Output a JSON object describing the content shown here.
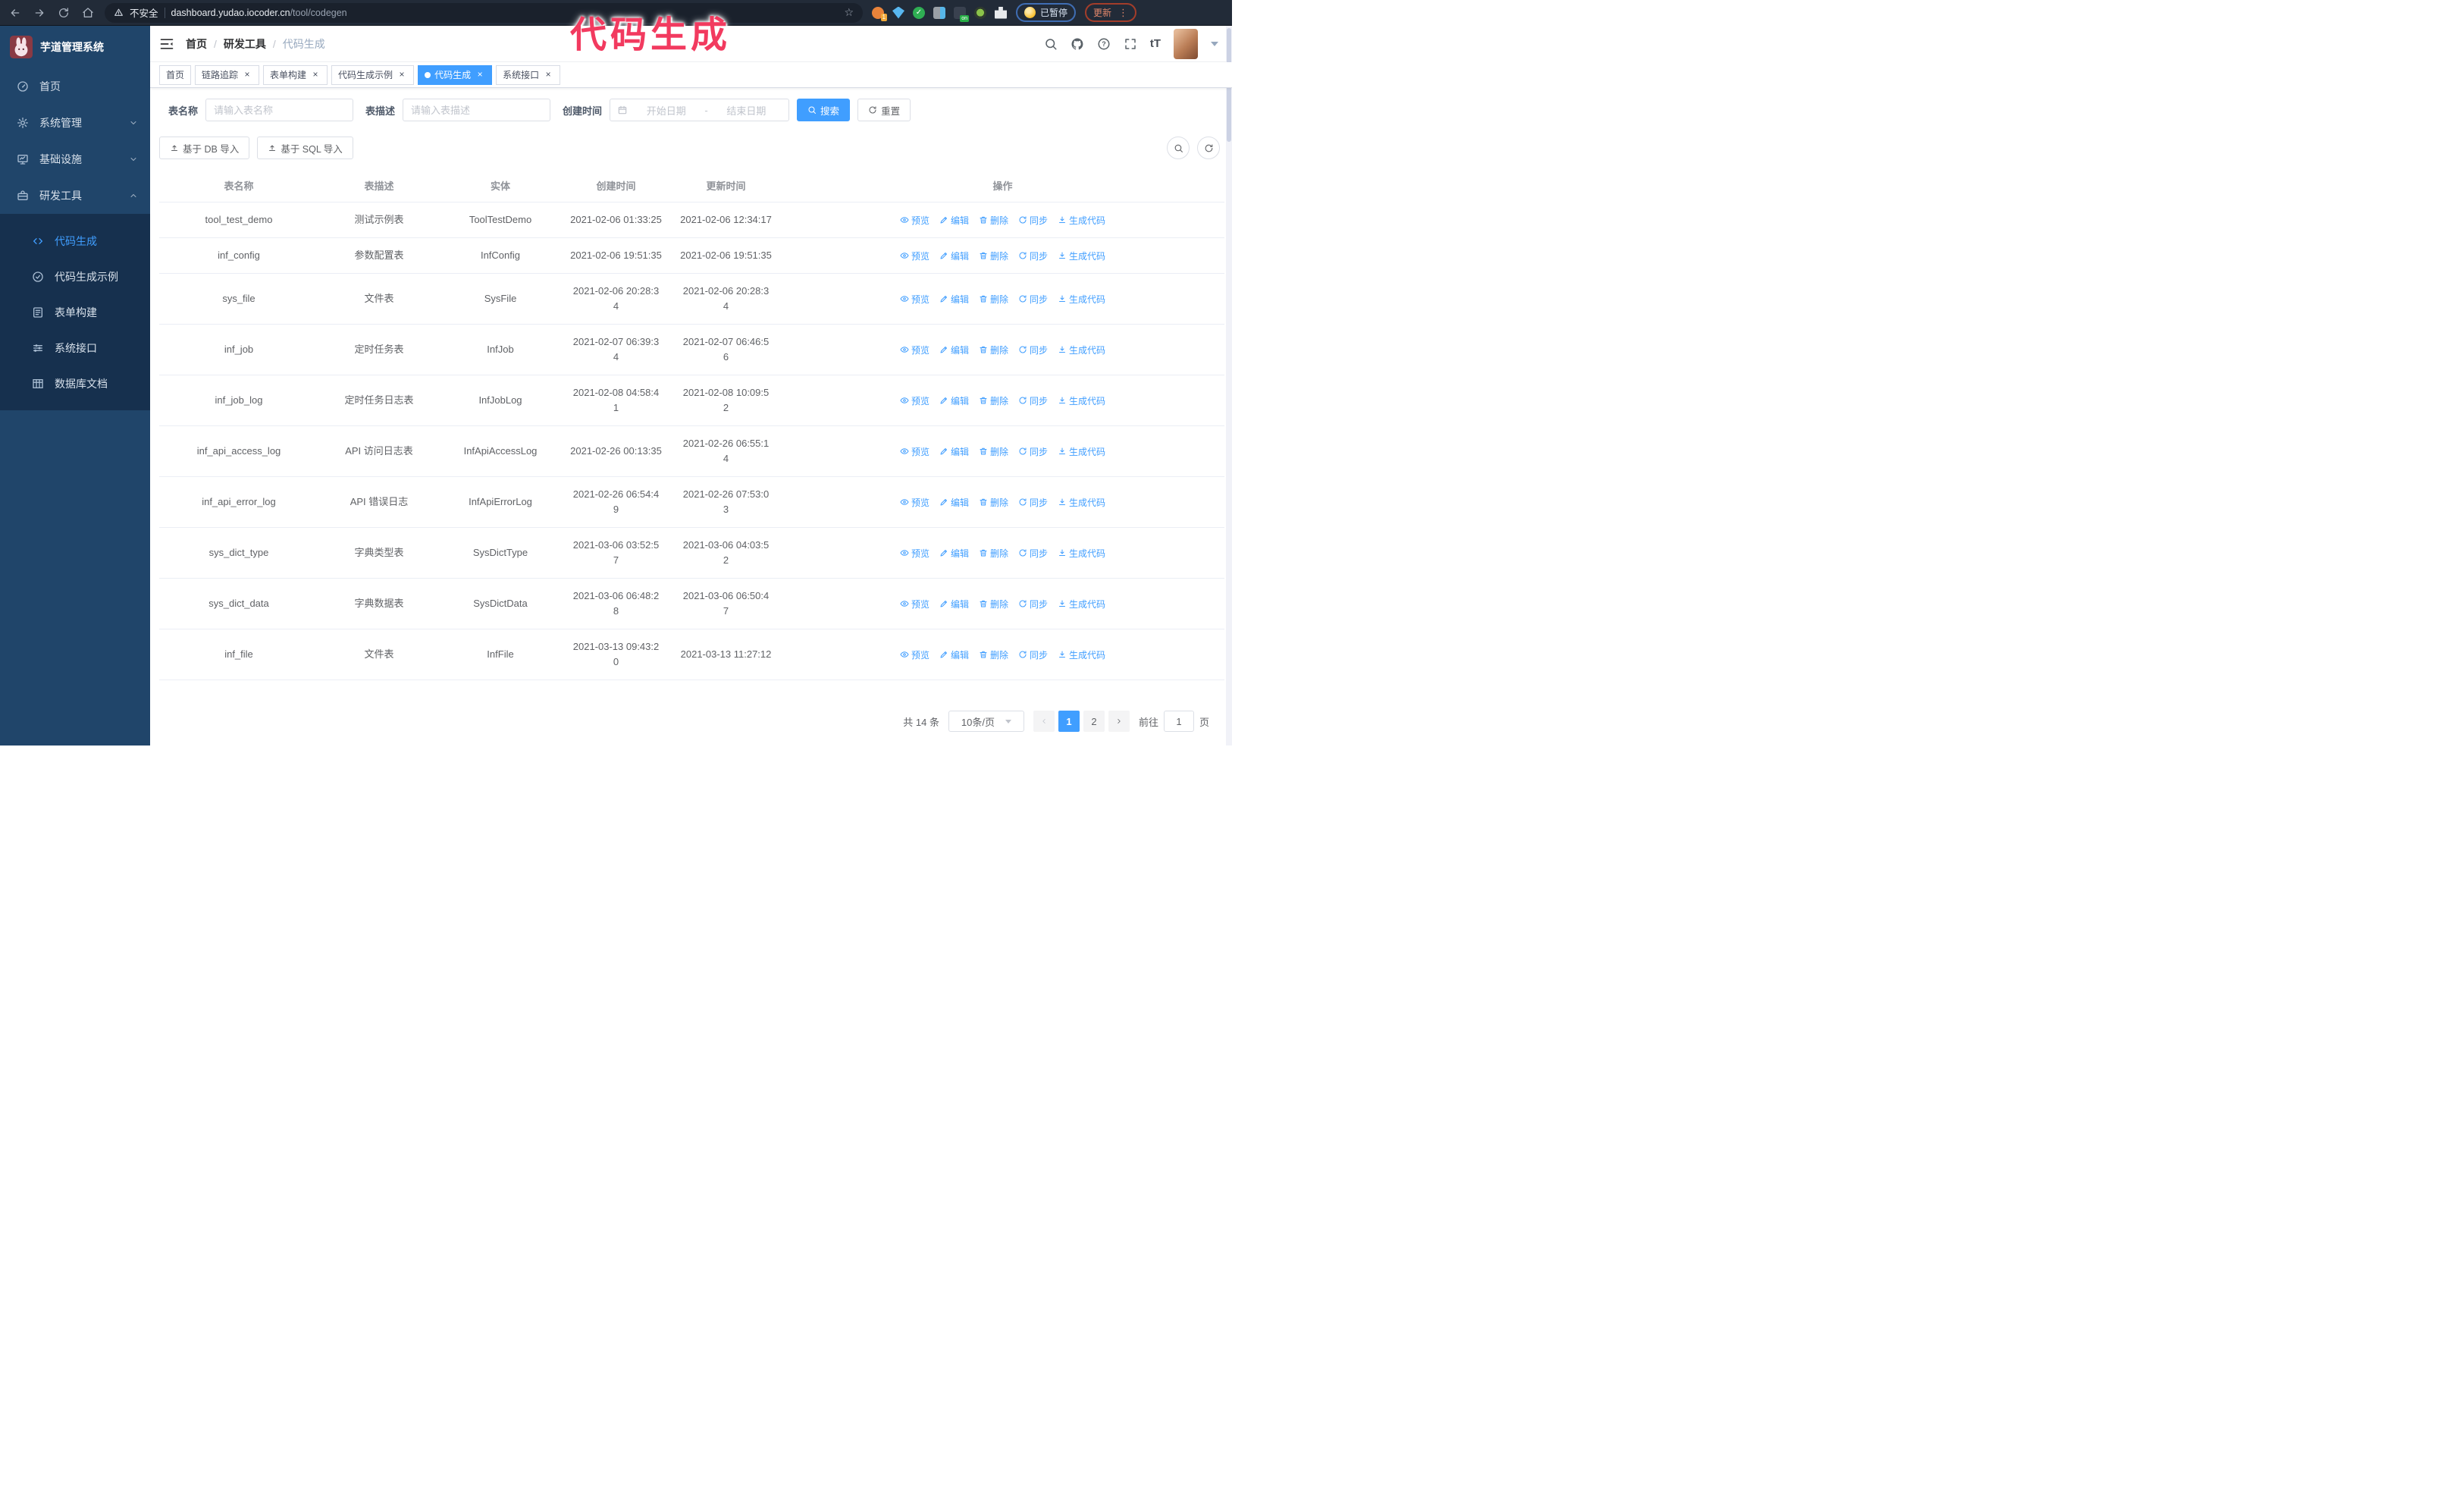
{
  "colors": {
    "accent": "#409eff",
    "annotation": "#f23a5f",
    "sidebar_bg": "#20456a",
    "submenu_bg": "#16304e",
    "browser_bar_bg": "#222b38"
  },
  "browser": {
    "security_label": "不安全",
    "url_domain": "dashboard.yudao.iocoder.cn",
    "url_path": "/tool/codegen",
    "profile_status": "已暂停",
    "update_label": "更新",
    "extension_badge_count": "1",
    "extension_badge_on": "on"
  },
  "annotation": {
    "text": "代码生成"
  },
  "sidebar": {
    "title": "芋道管理系统",
    "items": [
      {
        "label": "首页",
        "icon": "dashboard",
        "expandable": false,
        "expanded": false
      },
      {
        "label": "系统管理",
        "icon": "gear",
        "expandable": true,
        "expanded": false
      },
      {
        "label": "基础设施",
        "icon": "monitor",
        "expandable": true,
        "expanded": false
      },
      {
        "label": "研发工具",
        "icon": "toolbox",
        "expandable": true,
        "expanded": true
      }
    ],
    "submenu": [
      {
        "label": "代码生成",
        "icon": "code",
        "active": true
      },
      {
        "label": "代码生成示例",
        "icon": "badge",
        "active": false
      },
      {
        "label": "表单构建",
        "icon": "form",
        "active": false
      },
      {
        "label": "系统接口",
        "icon": "sliders",
        "active": false
      },
      {
        "label": "数据库文档",
        "icon": "dbtable",
        "active": false
      }
    ]
  },
  "header": {
    "breadcrumb": [
      "首页",
      "研发工具",
      "代码生成"
    ],
    "breadcrumb_separator": "/",
    "size_icon_label": "tT"
  },
  "tags": [
    {
      "label": "首页",
      "closable": false,
      "active": false
    },
    {
      "label": "链路追踪",
      "closable": true,
      "active": false
    },
    {
      "label": "表单构建",
      "closable": true,
      "active": false
    },
    {
      "label": "代码生成示例",
      "closable": true,
      "active": false
    },
    {
      "label": "代码生成",
      "closable": true,
      "active": true
    },
    {
      "label": "系统接口",
      "closable": true,
      "active": false
    }
  ],
  "filters": {
    "name_label": "表名称",
    "name_placeholder": "请输入表名称",
    "desc_label": "表描述",
    "desc_placeholder": "请输入表描述",
    "time_label": "创建时间",
    "start_placeholder": "开始日期",
    "range_separator": "-",
    "end_placeholder": "结束日期",
    "search_label": "搜索",
    "reset_label": "重置"
  },
  "toolbar": {
    "import_db_label": "基于 DB 导入",
    "import_sql_label": "基于 SQL 导入"
  },
  "table": {
    "columns": [
      "表名称",
      "表描述",
      "实体",
      "创建时间",
      "更新时间",
      "操作"
    ],
    "action_labels": [
      "预览",
      "编辑",
      "删除",
      "同步",
      "生成代码"
    ],
    "action_icons": [
      "eye",
      "edit",
      "trash",
      "sync",
      "download"
    ],
    "rows": [
      {
        "name": "tool_test_demo",
        "desc": "测试示例表",
        "entity": "ToolTestDemo",
        "created": "2021-02-06 01:33:25",
        "updated": "2021-02-06 12:34:17"
      },
      {
        "name": "inf_config",
        "desc": "参数配置表",
        "entity": "InfConfig",
        "created": "2021-02-06 19:51:35",
        "updated": "2021-02-06 19:51:35"
      },
      {
        "name": "sys_file",
        "desc": "文件表",
        "entity": "SysFile",
        "created": "2021-02-06 20:28:3\n4",
        "updated": "2021-02-06 20:28:3\n4"
      },
      {
        "name": "inf_job",
        "desc": "定时任务表",
        "entity": "InfJob",
        "created": "2021-02-07 06:39:3\n4",
        "updated": "2021-02-07 06:46:5\n6"
      },
      {
        "name": "inf_job_log",
        "desc": "定时任务日志表",
        "entity": "InfJobLog",
        "created": "2021-02-08 04:58:4\n1",
        "updated": "2021-02-08 10:09:5\n2"
      },
      {
        "name": "inf_api_access_log",
        "desc": "API 访问日志表",
        "entity": "InfApiAccessLog",
        "created": "2021-02-26 00:13:35",
        "updated": "2021-02-26 06:55:1\n4"
      },
      {
        "name": "inf_api_error_log",
        "desc": "API 错误日志",
        "entity": "InfApiErrorLog",
        "created": "2021-02-26 06:54:4\n9",
        "updated": "2021-02-26 07:53:0\n3"
      },
      {
        "name": "sys_dict_type",
        "desc": "字典类型表",
        "entity": "SysDictType",
        "created": "2021-03-06 03:52:5\n7",
        "updated": "2021-03-06 04:03:5\n2"
      },
      {
        "name": "sys_dict_data",
        "desc": "字典数据表",
        "entity": "SysDictData",
        "created": "2021-03-06 06:48:2\n8",
        "updated": "2021-03-06 06:50:4\n7"
      },
      {
        "name": "inf_file",
        "desc": "文件表",
        "entity": "InfFile",
        "created": "2021-03-13 09:43:2\n0",
        "updated": "2021-03-13 11:27:12"
      }
    ]
  },
  "pagination": {
    "total": "共 14 条",
    "page_size": "10条/页",
    "pages": [
      "1",
      "2"
    ],
    "active_page": "1",
    "goto_label": "前往",
    "goto_value": "1",
    "goto_unit": "页"
  },
  "ui": {
    "close_glyph": "×",
    "star_glyph": "☆",
    "kebab_glyph": "⋮",
    "shield_check_glyph": "✓"
  }
}
